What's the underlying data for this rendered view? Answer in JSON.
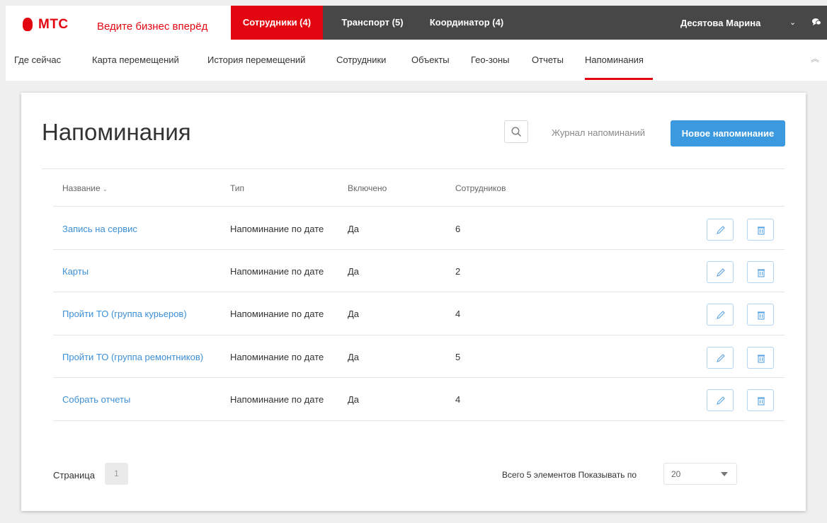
{
  "header": {
    "brand_name": "МТС",
    "brand_slogan": "Ведите бизнес вперёд",
    "tabs": [
      {
        "label": "Сотрудники (4)",
        "active": true
      },
      {
        "label": "Транспорт (5)",
        "active": false
      },
      {
        "label": "Координатор (4)",
        "active": false
      }
    ],
    "user_name": "Десятова Марина",
    "user_chevron": "⌄",
    "icons": {
      "user_menu": "chevron-down-icon",
      "chat": "chat-icon"
    }
  },
  "subnav": {
    "items": [
      "Где сейчас",
      "Карта перемещений",
      "История перемещений",
      "Сотрудники",
      "Объекты",
      "Гео-зоны",
      "Отчеты",
      "Напоминания"
    ],
    "active_index": 7,
    "collapse_glyph": "︽"
  },
  "page": {
    "title": "Напоминания",
    "journal_link": "Журнал напоминаний",
    "new_button": "Новое напоминание"
  },
  "table": {
    "columns": {
      "name": "Название",
      "type": "Тип",
      "enabled": "Включено",
      "employees": "Сотрудников"
    },
    "sort_chevron": "⌄",
    "rows": [
      {
        "name": "Запись на сервис",
        "type": "Напоминание по дате",
        "enabled": "Да",
        "employees": "6"
      },
      {
        "name": "Карты",
        "type": "Напоминание по дате",
        "enabled": "Да",
        "employees": "2"
      },
      {
        "name": "Пройти ТО (группа курьеров)",
        "type": "Напоминание по дате",
        "enabled": "Да",
        "employees": "4"
      },
      {
        "name": "Пройти ТО (группа ремонтников)",
        "type": "Напоминание по дате",
        "enabled": "Да",
        "employees": "5"
      },
      {
        "name": "Собрать отчеты",
        "type": "Напоминание по дате",
        "enabled": "Да",
        "employees": "4"
      }
    ]
  },
  "pagination": {
    "page_label": "Страница",
    "current_page": "1",
    "total_label": "Всего 5 элементов  Показывать по",
    "page_size": "20"
  },
  "colors": {
    "brand_red": "#e30611",
    "accent_blue": "#3b99e0",
    "link_blue": "#3d8fd6",
    "topbar": "#474747"
  }
}
